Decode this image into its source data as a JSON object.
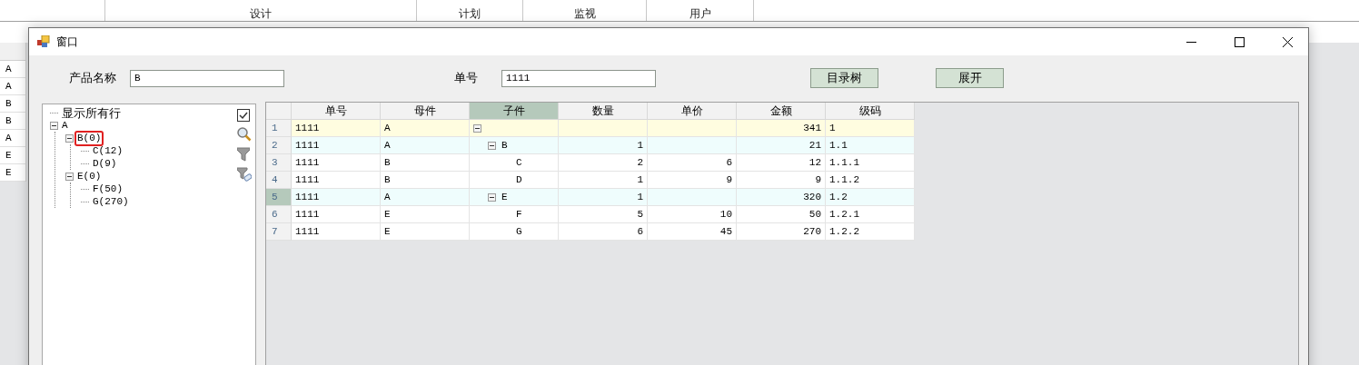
{
  "background_app": {
    "menu": [
      "设计",
      "计划",
      "监视",
      "用户"
    ],
    "left_column": [
      "A",
      "A",
      "B",
      "B",
      "A",
      "E",
      "E"
    ]
  },
  "window": {
    "title": "窗口"
  },
  "form": {
    "product_label": "产品名称",
    "product_value": "B",
    "order_label": "单号",
    "order_value": "1111",
    "buttons": [
      "目录树",
      "展开"
    ]
  },
  "tree": {
    "items": [
      {
        "label": "显示所有行",
        "selected": false
      },
      {
        "label": "A",
        "selected": false,
        "expanded": true,
        "children": [
          {
            "label": "B(0)",
            "selected": true,
            "expanded": true,
            "children": [
              {
                "label": "C(12)",
                "selected": false
              },
              {
                "label": "D(9)",
                "selected": false
              }
            ]
          },
          {
            "label": "E(0)",
            "selected": false,
            "expanded": true,
            "children": [
              {
                "label": "F(50)",
                "selected": false
              },
              {
                "label": "G(270)",
                "selected": false
              }
            ]
          }
        ]
      }
    ]
  },
  "table": {
    "columns": [
      {
        "label": "单号",
        "selected": false
      },
      {
        "label": "母件",
        "selected": false
      },
      {
        "label": "子件",
        "selected": true
      },
      {
        "label": "数量",
        "selected": false
      },
      {
        "label": "单价",
        "selected": false
      },
      {
        "label": "金额",
        "selected": false
      },
      {
        "label": "级码",
        "selected": false
      }
    ],
    "rows": [
      {
        "number": "1",
        "order_no": "1111",
        "parent": "A",
        "amount": "341",
        "level_code": "1",
        "expanded": true,
        "selected": false,
        "children": [
          {
            "number": "2",
            "order_no": "1111",
            "parent": "A",
            "part": "B",
            "qty": "1",
            "amount": "21",
            "level_code": "1.1",
            "expanded": true,
            "selected": false,
            "children": [
              {
                "number": "3",
                "order_no": "1111",
                "parent": "B",
                "part": "C",
                "qty": "2",
                "price": "6",
                "amount": "12",
                "level_code": "1.1.1",
                "selected": false
              },
              {
                "number": "4",
                "order_no": "1111",
                "parent": "B",
                "part": "D",
                "qty": "1",
                "price": "9",
                "amount": "9",
                "level_code": "1.1.2",
                "selected": false
              }
            ]
          },
          {
            "number": "5",
            "order_no": "1111",
            "parent": "A",
            "part": "E",
            "qty": "1",
            "amount": "320",
            "level_code": "1.2",
            "expanded": true,
            "selected": true,
            "children": [
              {
                "number": "6",
                "order_no": "1111",
                "parent": "E",
                "part": "F",
                "qty": "5",
                "price": "10",
                "amount": "50",
                "level_code": "1.2.1",
                "selected": false
              },
              {
                "number": "7",
                "order_no": "1111",
                "parent": "E",
                "part": "G",
                "qty": "6",
                "price": "45",
                "amount": "270",
                "level_code": "1.2.2",
                "selected": false
              }
            ]
          }
        ]
      }
    ]
  }
}
